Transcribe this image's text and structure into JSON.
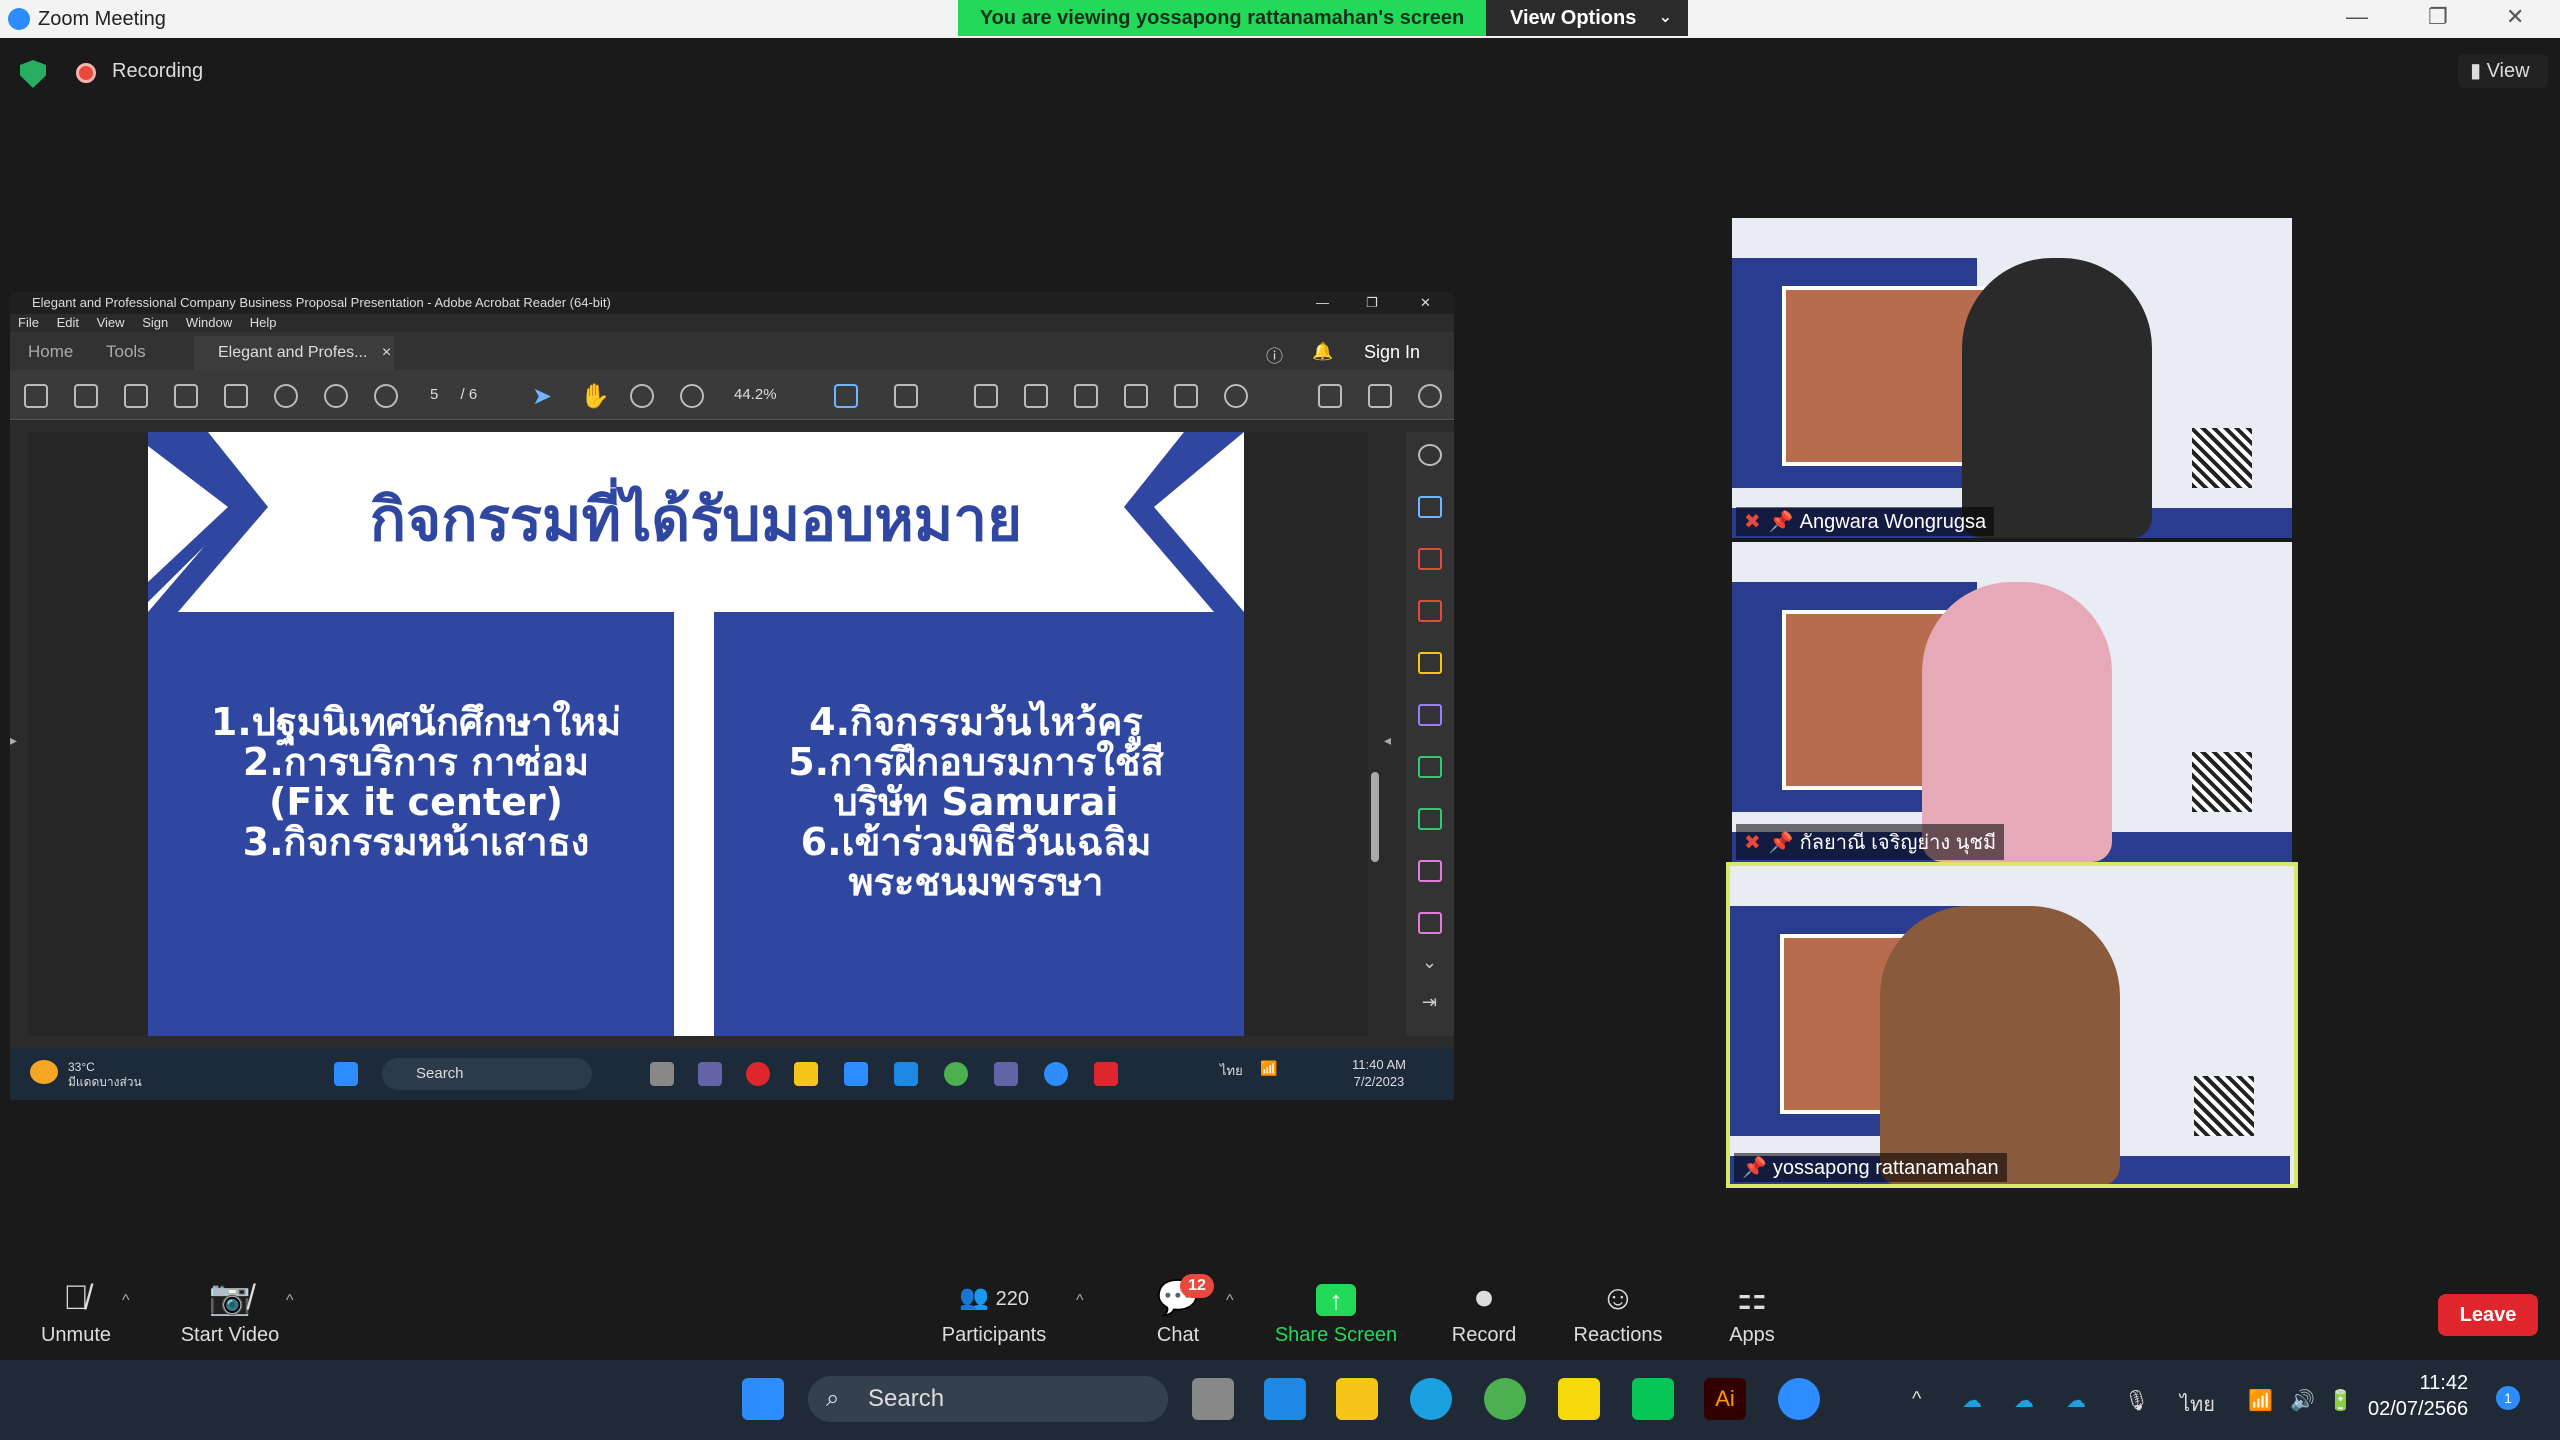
{
  "window": {
    "title": "Zoom Meeting"
  },
  "banner": {
    "text": "You are viewing yossapong rattanamahan's screen",
    "view_options": "View Options"
  },
  "status": {
    "recording": "Recording",
    "view": "View"
  },
  "acrobat": {
    "title": "Elegant and Professional Company Business Proposal Presentation - Adobe Acrobat Reader (64-bit)",
    "menu": [
      "File",
      "Edit",
      "View",
      "Sign",
      "Window",
      "Help"
    ],
    "tabs": {
      "home": "Home",
      "tools": "Tools",
      "doc": "Elegant and Profes..."
    },
    "sign_in": "Sign In",
    "page_current": "5",
    "page_total": "/ 6",
    "zoom": "44.2%"
  },
  "slide": {
    "title": "กิจกรรมที่ได้รับมอบหมาย",
    "left": [
      "1.ปฐมนิเทศนักศึกษาใหม่",
      "2.การบริการ กาซ่อม",
      "(Fix it center)",
      "3.กิจกรรมหน้าเสาธง"
    ],
    "right": [
      "4.กิจกรรมวันไหว้ครู",
      "5.การฝึกอบรมการใช้สี",
      "บริษัท Samurai",
      "6.เข้าร่วมพิธีวันเฉลิม",
      "พระชนมพรรษา"
    ]
  },
  "inner_taskbar": {
    "weather_temp": "33°C",
    "weather_desc": "มีแดดบางส่วน",
    "search": "Search",
    "time": "11:40 AM",
    "date": "7/2/2023",
    "lang": "ไทย"
  },
  "participants_tiles": [
    {
      "name": "Angwara Wongrugsa"
    },
    {
      "name": "กัลยาณี เจริญย่าง นุชมี"
    },
    {
      "name": "yossapong rattanamahan"
    }
  ],
  "toolbar": {
    "unmute": "Unmute",
    "start_video": "Start Video",
    "participants": "Participants",
    "participants_count": "220",
    "chat": "Chat",
    "chat_badge": "12",
    "share_screen": "Share Screen",
    "record": "Record",
    "reactions": "Reactions",
    "apps": "Apps",
    "leave": "Leave"
  },
  "taskbar": {
    "search": "Search",
    "time": "11:42",
    "date": "02/07/2566",
    "lang": "ไทย",
    "badge": "1"
  }
}
